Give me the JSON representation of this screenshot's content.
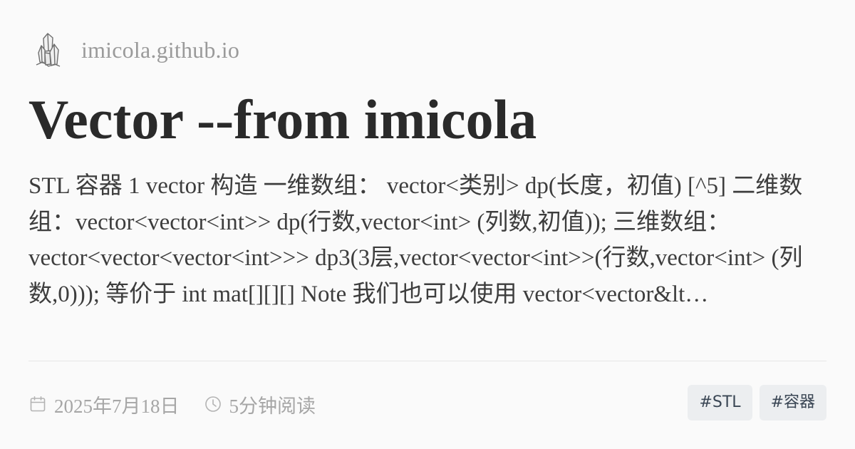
{
  "site": {
    "name": "imicola.github.io",
    "logo_icon": "crystal-icon"
  },
  "post": {
    "title": "Vector --from imicola",
    "excerpt": "STL 容器 1 vector 构造 一维数组：  vector<类别> dp(长度，初值) [^5] 二维数组：vector<vector<int>> dp(行数,vector<int> (列数,初值)); 三维数组：  vector<vector<vector<int>>> dp3(3层,vector<vector<int>>(行数,vector<int> (列数,0))); 等价于 int mat[][][] Note 我们也可以使用 vector<vector&lt…"
  },
  "meta": {
    "date": "2025年7月18日",
    "date_icon": "calendar-icon",
    "read_time": "5分钟阅读",
    "read_time_icon": "clock-icon"
  },
  "tags": [
    {
      "label": "#STL"
    },
    {
      "label": "#容器"
    }
  ],
  "colors": {
    "background": "#fafafa",
    "title": "#2a2a2a",
    "muted": "#9a9a9a",
    "tag_bg": "#eceef0",
    "tag_text": "#3a4654"
  }
}
